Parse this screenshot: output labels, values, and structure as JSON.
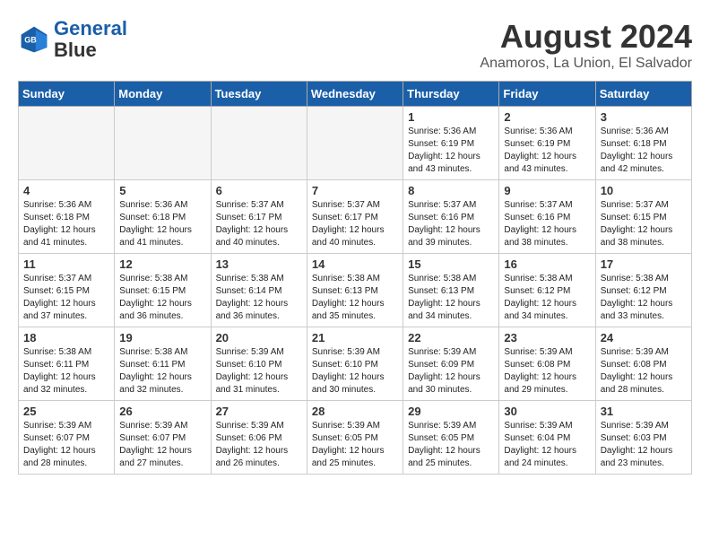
{
  "header": {
    "logo_line1": "General",
    "logo_line2": "Blue",
    "month_year": "August 2024",
    "location": "Anamoros, La Union, El Salvador"
  },
  "days_of_week": [
    "Sunday",
    "Monday",
    "Tuesday",
    "Wednesday",
    "Thursday",
    "Friday",
    "Saturday"
  ],
  "weeks": [
    [
      {
        "day": "",
        "text": "",
        "empty": true
      },
      {
        "day": "",
        "text": "",
        "empty": true
      },
      {
        "day": "",
        "text": "",
        "empty": true
      },
      {
        "day": "",
        "text": "",
        "empty": true
      },
      {
        "day": "1",
        "text": "Sunrise: 5:36 AM\nSunset: 6:19 PM\nDaylight: 12 hours\nand 43 minutes.",
        "empty": false
      },
      {
        "day": "2",
        "text": "Sunrise: 5:36 AM\nSunset: 6:19 PM\nDaylight: 12 hours\nand 43 minutes.",
        "empty": false
      },
      {
        "day": "3",
        "text": "Sunrise: 5:36 AM\nSunset: 6:18 PM\nDaylight: 12 hours\nand 42 minutes.",
        "empty": false
      }
    ],
    [
      {
        "day": "4",
        "text": "Sunrise: 5:36 AM\nSunset: 6:18 PM\nDaylight: 12 hours\nand 41 minutes.",
        "empty": false
      },
      {
        "day": "5",
        "text": "Sunrise: 5:36 AM\nSunset: 6:18 PM\nDaylight: 12 hours\nand 41 minutes.",
        "empty": false
      },
      {
        "day": "6",
        "text": "Sunrise: 5:37 AM\nSunset: 6:17 PM\nDaylight: 12 hours\nand 40 minutes.",
        "empty": false
      },
      {
        "day": "7",
        "text": "Sunrise: 5:37 AM\nSunset: 6:17 PM\nDaylight: 12 hours\nand 40 minutes.",
        "empty": false
      },
      {
        "day": "8",
        "text": "Sunrise: 5:37 AM\nSunset: 6:16 PM\nDaylight: 12 hours\nand 39 minutes.",
        "empty": false
      },
      {
        "day": "9",
        "text": "Sunrise: 5:37 AM\nSunset: 6:16 PM\nDaylight: 12 hours\nand 38 minutes.",
        "empty": false
      },
      {
        "day": "10",
        "text": "Sunrise: 5:37 AM\nSunset: 6:15 PM\nDaylight: 12 hours\nand 38 minutes.",
        "empty": false
      }
    ],
    [
      {
        "day": "11",
        "text": "Sunrise: 5:37 AM\nSunset: 6:15 PM\nDaylight: 12 hours\nand 37 minutes.",
        "empty": false
      },
      {
        "day": "12",
        "text": "Sunrise: 5:38 AM\nSunset: 6:15 PM\nDaylight: 12 hours\nand 36 minutes.",
        "empty": false
      },
      {
        "day": "13",
        "text": "Sunrise: 5:38 AM\nSunset: 6:14 PM\nDaylight: 12 hours\nand 36 minutes.",
        "empty": false
      },
      {
        "day": "14",
        "text": "Sunrise: 5:38 AM\nSunset: 6:13 PM\nDaylight: 12 hours\nand 35 minutes.",
        "empty": false
      },
      {
        "day": "15",
        "text": "Sunrise: 5:38 AM\nSunset: 6:13 PM\nDaylight: 12 hours\nand 34 minutes.",
        "empty": false
      },
      {
        "day": "16",
        "text": "Sunrise: 5:38 AM\nSunset: 6:12 PM\nDaylight: 12 hours\nand 34 minutes.",
        "empty": false
      },
      {
        "day": "17",
        "text": "Sunrise: 5:38 AM\nSunset: 6:12 PM\nDaylight: 12 hours\nand 33 minutes.",
        "empty": false
      }
    ],
    [
      {
        "day": "18",
        "text": "Sunrise: 5:38 AM\nSunset: 6:11 PM\nDaylight: 12 hours\nand 32 minutes.",
        "empty": false
      },
      {
        "day": "19",
        "text": "Sunrise: 5:38 AM\nSunset: 6:11 PM\nDaylight: 12 hours\nand 32 minutes.",
        "empty": false
      },
      {
        "day": "20",
        "text": "Sunrise: 5:39 AM\nSunset: 6:10 PM\nDaylight: 12 hours\nand 31 minutes.",
        "empty": false
      },
      {
        "day": "21",
        "text": "Sunrise: 5:39 AM\nSunset: 6:10 PM\nDaylight: 12 hours\nand 30 minutes.",
        "empty": false
      },
      {
        "day": "22",
        "text": "Sunrise: 5:39 AM\nSunset: 6:09 PM\nDaylight: 12 hours\nand 30 minutes.",
        "empty": false
      },
      {
        "day": "23",
        "text": "Sunrise: 5:39 AM\nSunset: 6:08 PM\nDaylight: 12 hours\nand 29 minutes.",
        "empty": false
      },
      {
        "day": "24",
        "text": "Sunrise: 5:39 AM\nSunset: 6:08 PM\nDaylight: 12 hours\nand 28 minutes.",
        "empty": false
      }
    ],
    [
      {
        "day": "25",
        "text": "Sunrise: 5:39 AM\nSunset: 6:07 PM\nDaylight: 12 hours\nand 28 minutes.",
        "empty": false
      },
      {
        "day": "26",
        "text": "Sunrise: 5:39 AM\nSunset: 6:07 PM\nDaylight: 12 hours\nand 27 minutes.",
        "empty": false
      },
      {
        "day": "27",
        "text": "Sunrise: 5:39 AM\nSunset: 6:06 PM\nDaylight: 12 hours\nand 26 minutes.",
        "empty": false
      },
      {
        "day": "28",
        "text": "Sunrise: 5:39 AM\nSunset: 6:05 PM\nDaylight: 12 hours\nand 25 minutes.",
        "empty": false
      },
      {
        "day": "29",
        "text": "Sunrise: 5:39 AM\nSunset: 6:05 PM\nDaylight: 12 hours\nand 25 minutes.",
        "empty": false
      },
      {
        "day": "30",
        "text": "Sunrise: 5:39 AM\nSunset: 6:04 PM\nDaylight: 12 hours\nand 24 minutes.",
        "empty": false
      },
      {
        "day": "31",
        "text": "Sunrise: 5:39 AM\nSunset: 6:03 PM\nDaylight: 12 hours\nand 23 minutes.",
        "empty": false
      }
    ]
  ]
}
